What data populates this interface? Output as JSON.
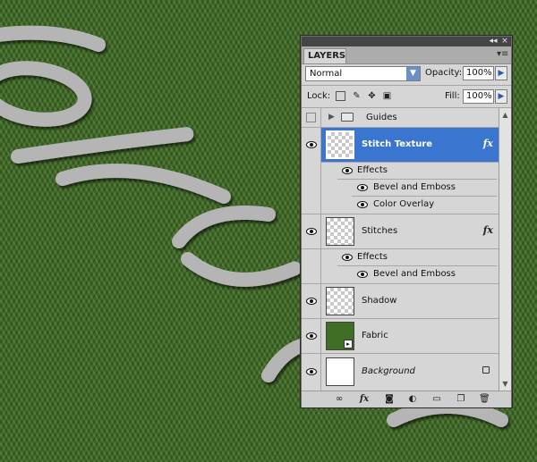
{
  "panel": {
    "tab_label": "LAYERS",
    "title_controls": [
      "◂◂",
      "×"
    ],
    "menu_icon": "panel-menu-icon",
    "blend_mode": "Normal",
    "opacity_label": "Opacity:",
    "opacity_value": "100%",
    "lock_label": "Lock:",
    "fill_label": "Fill:",
    "fill_value": "100%"
  },
  "layers": [
    {
      "name": "Guides",
      "type": "group"
    },
    {
      "name": "Stitch Texture",
      "type": "layer",
      "selected": true,
      "fx": "fx",
      "effects_label": "Effects",
      "effects": [
        "Bevel and Emboss",
        "Color Overlay"
      ]
    },
    {
      "name": "Stitches",
      "type": "layer",
      "fx": "fx",
      "effects_label": "Effects",
      "effects": [
        "Bevel and Emboss"
      ]
    },
    {
      "name": "Shadow",
      "type": "layer"
    },
    {
      "name": "Fabric",
      "type": "smart-object"
    },
    {
      "name": "Background",
      "type": "background"
    }
  ],
  "bottom_icons": [
    "link-icon",
    "fx-icon",
    "mask-icon",
    "adjustment-icon",
    "folder-icon",
    "new-layer-icon",
    "trash-icon"
  ],
  "colors": {
    "selection": "#3a76d0",
    "fabric": "#3d6a22",
    "stitch": "#b6b6b6"
  }
}
